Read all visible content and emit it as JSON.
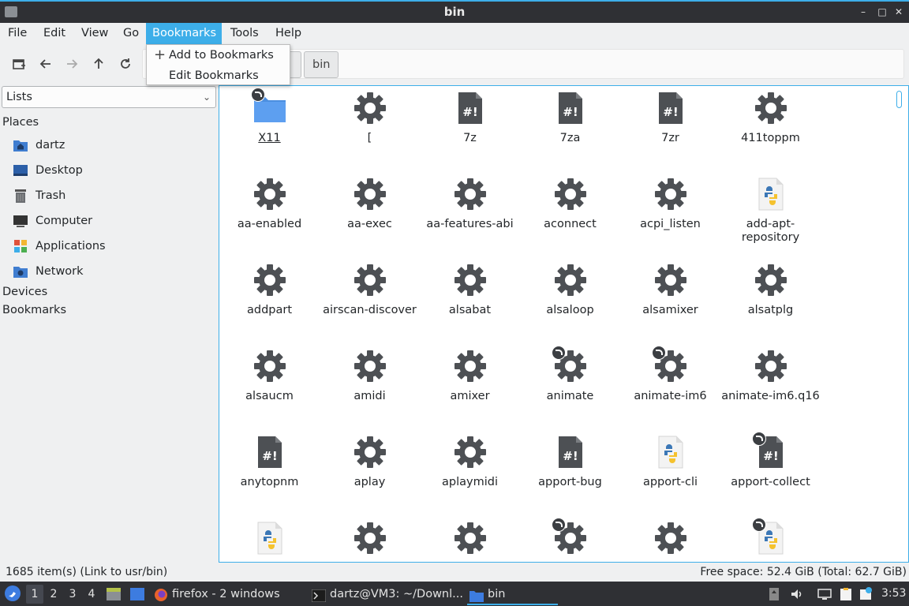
{
  "window": {
    "title": "bin"
  },
  "menubar": {
    "items": [
      {
        "label": "File",
        "left": 0
      },
      {
        "label": "Edit"
      },
      {
        "label": "View"
      },
      {
        "label": "Go"
      },
      {
        "label": "Bookmarks"
      },
      {
        "label": "Tools"
      },
      {
        "label": "Help"
      }
    ],
    "active": "Bookmarks"
  },
  "bookmarks_menu": {
    "items": [
      "Add to Bookmarks",
      "Edit Bookmarks"
    ]
  },
  "pathbar": {
    "current": "bin"
  },
  "sidebar": {
    "mode": "Lists",
    "places_heading": "Places",
    "places": [
      "dartz",
      "Desktop",
      "Trash",
      "Computer",
      "Applications",
      "Network"
    ],
    "devices_heading": "Devices",
    "bookmarks_heading": "Bookmarks"
  },
  "files": [
    {
      "name": "X11",
      "icon": "folder-link-icon"
    },
    {
      "name": "[",
      "icon": "gear-icon"
    },
    {
      "name": "7z",
      "icon": "script-icon"
    },
    {
      "name": "7za",
      "icon": "script-icon"
    },
    {
      "name": "7zr",
      "icon": "script-icon"
    },
    {
      "name": "411toppm",
      "icon": "gear-icon"
    },
    {
      "name": "aa-enabled",
      "icon": "gear-icon"
    },
    {
      "name": "aa-exec",
      "icon": "gear-icon"
    },
    {
      "name": "aa-features-abi",
      "icon": "gear-icon"
    },
    {
      "name": "aconnect",
      "icon": "gear-icon"
    },
    {
      "name": "acpi_listen",
      "icon": "gear-icon"
    },
    {
      "name": "add-apt-repository",
      "icon": "python-icon"
    },
    {
      "name": "addpart",
      "icon": "gear-icon"
    },
    {
      "name": "airscan-discover",
      "icon": "gear-icon"
    },
    {
      "name": "alsabat",
      "icon": "gear-icon"
    },
    {
      "name": "alsaloop",
      "icon": "gear-icon"
    },
    {
      "name": "alsamixer",
      "icon": "gear-icon"
    },
    {
      "name": "alsatplg",
      "icon": "gear-icon"
    },
    {
      "name": "alsaucm",
      "icon": "gear-icon"
    },
    {
      "name": "amidi",
      "icon": "gear-icon"
    },
    {
      "name": "amixer",
      "icon": "gear-icon"
    },
    {
      "name": "animate",
      "icon": "gear-link-icon"
    },
    {
      "name": "animate-im6",
      "icon": "gear-link-icon"
    },
    {
      "name": "animate-im6.q16",
      "icon": "gear-icon"
    },
    {
      "name": "anytopnm",
      "icon": "script-icon"
    },
    {
      "name": "aplay",
      "icon": "gear-icon"
    },
    {
      "name": "aplaymidi",
      "icon": "gear-icon"
    },
    {
      "name": "apport-bug",
      "icon": "script-icon"
    },
    {
      "name": "apport-cli",
      "icon": "python-icon"
    },
    {
      "name": "apport-collect",
      "icon": "script-link-icon"
    },
    {
      "name": "",
      "icon": "python-icon"
    },
    {
      "name": "",
      "icon": "gear-icon"
    },
    {
      "name": "",
      "icon": "gear-icon"
    },
    {
      "name": "",
      "icon": "gear-link-icon"
    },
    {
      "name": "",
      "icon": "gear-icon"
    },
    {
      "name": "",
      "icon": "python-link-icon"
    }
  ],
  "status": {
    "left": "1685 item(s) (Link to usr/bin)",
    "right": "Free space: 52.4 GiB (Total: 62.7 GiB)"
  },
  "taskbar": {
    "workspaces": [
      "1",
      "2",
      "3",
      "4"
    ],
    "tasks": [
      "firefox - 2 windows",
      "dartz@VM3: ~/Downl...",
      "bin"
    ],
    "clock": "3:53"
  },
  "colors": {
    "accent": "#3daee9",
    "panel": "#2f3034",
    "icon_dark": "#4d5054",
    "folder": "#4c8fe0"
  }
}
